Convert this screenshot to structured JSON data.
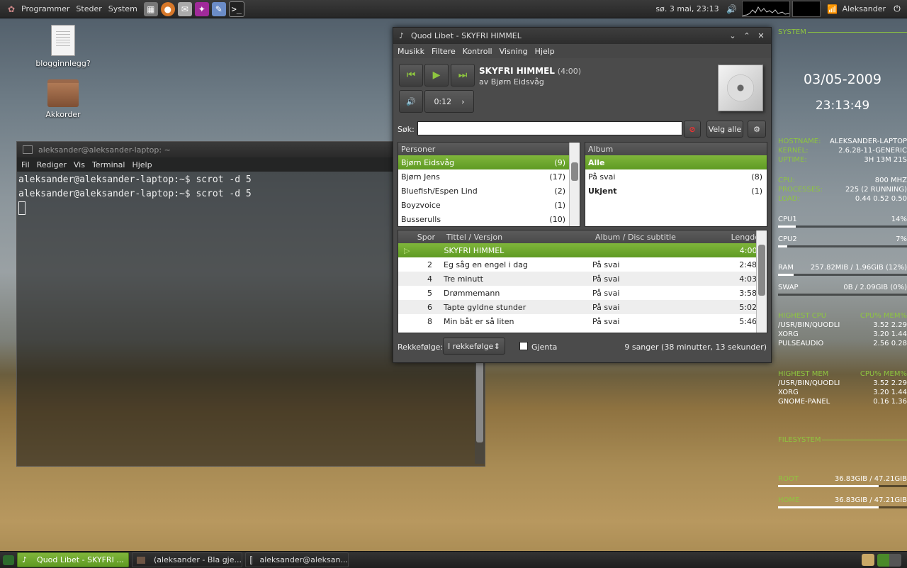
{
  "top_panel": {
    "menus": [
      "Programmer",
      "Steder",
      "System"
    ],
    "clock": "sø. 3 mai, 23:13",
    "user": "Aleksander"
  },
  "desktop_icons": [
    {
      "label": "blogginnlegg?",
      "icon": "text-document-icon"
    },
    {
      "label": "Akkorder",
      "icon": "folder-icon"
    }
  ],
  "terminal": {
    "title": "aleksander@aleksander-laptop: ~",
    "menu": [
      "Fil",
      "Rediger",
      "Vis",
      "Terminal",
      "Hjelp"
    ],
    "lines": [
      "aleksander@aleksander-laptop:~$ scrot -d 5",
      "aleksander@aleksander-laptop:~$ scrot -d 5"
    ]
  },
  "player": {
    "title": "Quod Libet - SKYFRI HIMMEL",
    "menu": [
      "Musikk",
      "Filtere",
      "Kontroll",
      "Visning",
      "Hjelp"
    ],
    "song_title": "SKYFRI HIMMEL",
    "song_duration": "(4:00)",
    "song_artist": "av Bjørn Eidsvåg",
    "position": "0:12",
    "search_label": "Søk:",
    "search_value": "",
    "select_all": "Velg alle",
    "persons_header": "Personer",
    "persons": [
      {
        "name": "Bjørn Eidsvåg",
        "count": "(9)",
        "selected": true
      },
      {
        "name": "Bjørn Jens",
        "count": "(17)"
      },
      {
        "name": "Bluefish/Espen Lind",
        "count": "(2)"
      },
      {
        "name": "Boyzvoice",
        "count": "(1)"
      },
      {
        "name": "Busserulls",
        "count": "(10)"
      }
    ],
    "album_header": "Album",
    "albums": [
      {
        "name": "Alle",
        "count": "",
        "selected": true
      },
      {
        "name": "På svai",
        "count": "(8)"
      },
      {
        "name": "Ukjent",
        "count": "(1)"
      }
    ],
    "columns": {
      "spor": "Spor",
      "title": "Tittel / Versjon",
      "album": "Album / Disc subtitle",
      "length": "Lengde"
    },
    "tracks": [
      {
        "spor": "",
        "title": "SKYFRI HIMMEL",
        "album": "",
        "length": "4:00",
        "playing": true
      },
      {
        "spor": "2",
        "title": "Eg såg en engel i dag",
        "album": "På svai",
        "length": "2:48"
      },
      {
        "spor": "4",
        "title": "Tre minutt",
        "album": "På svai",
        "length": "4:03"
      },
      {
        "spor": "5",
        "title": "Drømmemann",
        "album": "På svai",
        "length": "3:58"
      },
      {
        "spor": "6",
        "title": "Tapte gyldne stunder",
        "album": "På svai",
        "length": "5:02"
      },
      {
        "spor": "8",
        "title": "Min båt er så liten",
        "album": "På svai",
        "length": "5:46"
      }
    ],
    "order_label": "Rekkefølge:",
    "order_value": "I rekkefølge",
    "repeat_label": "Gjenta",
    "status": "9 sanger (38 minutter, 13 sekunder)"
  },
  "conky": {
    "system_header": "SYSTEM",
    "date": "03/05-2009",
    "time": "23:13:49",
    "info": [
      {
        "k": "HOSTNAME:",
        "v": "ALEKSANDER-LAPTOP"
      },
      {
        "k": "KERNEL:",
        "v": "2.6.28-11-GENERIC"
      },
      {
        "k": "UPTIME:",
        "v": "3H 13M 21S"
      }
    ],
    "stats": [
      {
        "k": "CPU:",
        "v": "800 MHZ"
      },
      {
        "k": "PROCESSES:",
        "v": "225 (2 RUNNING)"
      },
      {
        "k": "LOAD:",
        "v": "0.44 0.52 0.50"
      }
    ],
    "cpu1": {
      "label": "CPU1",
      "value": "14%",
      "fraction": 0.14
    },
    "cpu2": {
      "label": "CPU2",
      "value": "7%",
      "fraction": 0.07
    },
    "ram": {
      "label": "RAM",
      "value": "257.82MIB / 1.96GIB (12%)",
      "fraction": 0.12
    },
    "swap": {
      "label": "SWAP",
      "value": "0B / 2.09GIB (0%)",
      "fraction": 0.0
    },
    "highest_cpu": {
      "title": "HIGHEST CPU",
      "cols": "CPU% MEM%",
      "rows": [
        {
          "name": "/USR/BIN/QUODLI",
          "v": "3.52 2.29"
        },
        {
          "name": "XORG",
          "v": "3.20 1.44"
        },
        {
          "name": "PULSEAUDIO",
          "v": "2.56 0.28"
        }
      ]
    },
    "highest_mem": {
      "title": "HIGHEST MEM",
      "cols": "CPU% MEM%",
      "rows": [
        {
          "name": "/USR/BIN/QUODLI",
          "v": "3.52 2.29"
        },
        {
          "name": "XORG",
          "v": "3.20 1.44"
        },
        {
          "name": "GNOME-PANEL",
          "v": "0.16 1.36"
        }
      ]
    },
    "fs_header": "FILESYSTEM",
    "root": {
      "label": "ROOT",
      "value": "36.83GIB / 47.21GIB",
      "fraction": 0.78
    },
    "home": {
      "label": "HOME",
      "value": "36.83GIB / 47.21GIB",
      "fraction": 0.78
    }
  },
  "taskbar": [
    {
      "label": "Quod Libet - SKYFRI ...",
      "active": true
    },
    {
      "label": "(aleksander - Bla gje...",
      "active": false
    },
    {
      "label": "aleksander@aleksan...",
      "active": false
    }
  ]
}
